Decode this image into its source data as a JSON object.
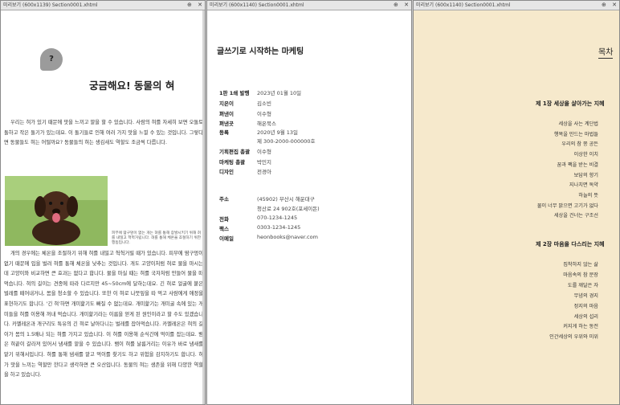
{
  "panes": [
    {
      "title": "미리보기 (600x1139) Section0001.xhtml",
      "pin": "⊕",
      "close": "✕"
    },
    {
      "title": "미리보기 (600x1140) Section0001.xhtml",
      "pin": "⊕",
      "close": "✕"
    },
    {
      "title": "미리보기 (600x1140) Section0001.xhtml",
      "pin": "⊕",
      "close": "✕"
    }
  ],
  "pane1": {
    "bubble": "?",
    "heading": "궁금해요! 동물의 혀",
    "intro": "우리는 혀가 있기 때문에 맛을 느끼고 말을 할 수 있습니다. 사람의 혀를 자세히 보면 오돌토돌하고 작은 돌기가 있는데요. 이 돌기들로 인해 여러 가지 맛을 느낄 수 있는 것입니다. 그렇다면 동물들도 혀는 어떨까요? 동물들의 혀는 생김새도 역할도 조금씩 다릅니다.",
    "caption": "피부에 땀구멍이 없는 개는 혀를 통해 증발시키기 위해 혀를 내밀고 헉헉거립니다. 혀를 통해 체온을 조절하기 위한 행동입니다.",
    "body": "개의 경우에는 체온을 조절하기 위해 혀를 내밀고 헉헉거릴 때가 있습니다. 피부에 땀구멍이 없기 때문에 입을 벌려 혀를 통해 체온을 낮추는 것입니다. 개도 고양이처럼 혀로 물을 마시는데 고양이와 비교하면 큰 효과는 없다고 합니다. 물을 마실 때는 혀를 국자처럼 만들어 물을 떠먹습니다. 혀의 길이는 견종에 따라 다르지만 45~50cm에 달하는데요. 긴 혀로 얼굴에 붙은 벌레를 떼어내거나, 몸을 청소할 수 있습니다. 또한 이 혀로 나뭇잎을 따 먹고 사람에게 애정을 표현하기도 합니다. '긴 혀'하면 개미핥기도 빠질 수 없는데요. 개미핥기는 개미굴 속에 있는 개미들을 혀를 이용해 꺼내 먹습니다. 개미핥기라는 이름을 얻게 된 원인이라고 할 수도 있겠습니다. 카멜레온과 개구리도 특유의 긴 혀로 날아다니는 벌레를 잡아먹습니다. 카멜레온은 혀의 길이가 몸의 1.5배나 되는 혀를 가지고 있습니다. 이 혀를 이용해 순식간에 먹이를 잡는데요. 뱀은 혀끝이 갈라져 있어서 냄새를 맡을 수 있습니다. 뱀이 혀를 날름거리는 이유가 바로 냄새를 맡기 위해서입니다. 혀를 통해 냄새를 맡고 먹이를 찾기도 하고 위험을 감지하기도 합니다. 혀가 맛을 느끼는 역할만 한다고 생각하면 큰 오산입니다. 동물의 혀는 생존을 위해 다양한 역할을 하고 있습니다."
  },
  "pane2": {
    "title": "글쓰기로 시작하는 마케팅",
    "rows": [
      {
        "k": "1판 1쇄 발행",
        "v": "2023년 01월 10일"
      },
      {
        "k": "지은이",
        "v": "김소빈"
      },
      {
        "k": "펴낸이",
        "v": "이수형"
      },
      {
        "k": "펴낸곳",
        "v": "해온북스"
      },
      {
        "k": "등록",
        "v": "2020년 9월 13일"
      },
      {
        "k": "",
        "v": "제 300-2000-000000호"
      },
      {
        "k": "기획편집 총괄",
        "v": "이수형"
      },
      {
        "k": "마케팅 총괄",
        "v": "박민지"
      },
      {
        "k": "디자인",
        "v": "전경아"
      },
      {
        "k": "주소",
        "v": "(45902) 부산시 해운대구"
      },
      {
        "k": "",
        "v": "청산로 24 902호(포세이돈)"
      },
      {
        "k": "전화",
        "v": "070-1234-1245"
      },
      {
        "k": "팩스",
        "v": "0303-1234-1245"
      },
      {
        "k": "이메일",
        "v": "heonbooks@naver.com"
      }
    ]
  },
  "pane3": {
    "toc_title": "목차",
    "chapter1": "제 1장 세상을 살아가는 지혜",
    "chapter1_items": [
      "세상을 사는 계단법",
      "행복을 만드는 마법들",
      "우리의 참 쫑 공든",
      "이상한 이치",
      "꿈과 쾍을 받는 비결",
      "보답의 향기",
      "지나치면 독약",
      "하늘의 뜻",
      "물이 너무 맑으면 고기가 없다",
      "세상을 건너는 구조선"
    ],
    "chapter2": "제 2장 마음을 다스리는 지혜",
    "chapter2_items": [
      "집착하지 않는 삶",
      "마음속의 참 문장",
      "도를 깨달은 자",
      "무념의 경지",
      "정지의 마음",
      "세상의 섭리",
      "커지게 하는 동전",
      "인간세상의 우위와 미위"
    ]
  }
}
